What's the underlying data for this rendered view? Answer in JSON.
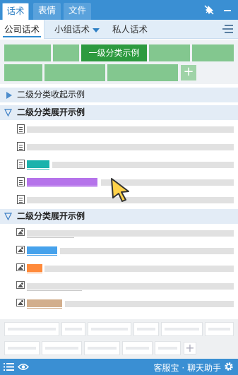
{
  "top_tabs": [
    {
      "label": "话术",
      "active": true
    },
    {
      "label": "表情",
      "active": false
    },
    {
      "label": "文件",
      "active": false
    }
  ],
  "top_icons": [
    "pin-off-icon",
    "minimize-icon"
  ],
  "sub_tabs": [
    {
      "label": "公司话术",
      "active": true
    },
    {
      "label": "小组话术",
      "dropdown": true
    },
    {
      "label": "私人话术"
    }
  ],
  "categories": {
    "selected_label": "一级分类示例"
  },
  "sections": [
    {
      "label": "二级分类收起示例",
      "expanded": false
    },
    {
      "label": "二级分类展开示例",
      "expanded": true
    },
    {
      "label": "二级分类展开示例",
      "expanded": true
    }
  ],
  "accent_colors": {
    "teal": "#1ab2ac",
    "purple": "#b573ea",
    "blue": "#46a2ec",
    "orange": "#ff8a3a",
    "tan": "#d2ae8c",
    "header_blue": "#3a8fd3",
    "green_selected": "#2d9a3f",
    "green": "#83c78f"
  },
  "footer": {
    "brand": "客服宝 · 聊天助手"
  }
}
